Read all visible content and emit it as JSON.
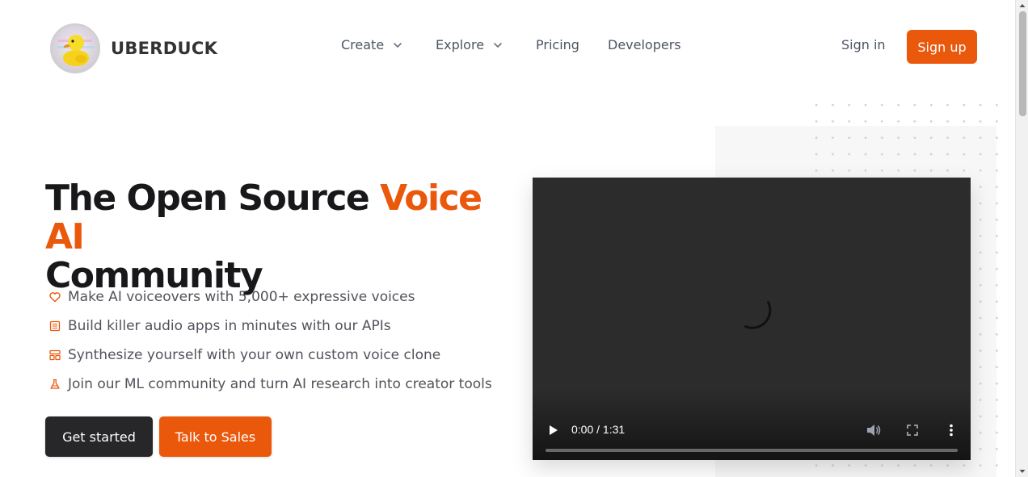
{
  "brand": {
    "name": "UBERDUCK"
  },
  "nav": {
    "items": [
      {
        "label": "Create",
        "has_dropdown": true
      },
      {
        "label": "Explore",
        "has_dropdown": true
      },
      {
        "label": "Pricing",
        "has_dropdown": false
      },
      {
        "label": "Developers",
        "has_dropdown": false
      }
    ],
    "sign_in": "Sign in",
    "sign_up": "Sign up"
  },
  "hero": {
    "headline_part1": "The Open Source ",
    "headline_accent": "Voice AI",
    "headline_part2": "Community",
    "features": [
      {
        "icon": "heart-icon",
        "text": "Make AI voiceovers with 5,000+ expressive voices"
      },
      {
        "icon": "document-list-icon",
        "text": "Build killer audio apps in minutes with our APIs"
      },
      {
        "icon": "layout-template-icon",
        "text": "Synthesize yourself with your own custom voice clone"
      },
      {
        "icon": "flask-icon",
        "text": "Join our ML community and turn AI research into creator tools"
      }
    ],
    "primary_cta": "Get started",
    "secondary_cta": "Talk to Sales"
  },
  "video": {
    "time_display": "0:00 / 1:31",
    "progress": 0.0,
    "state": "loading"
  },
  "colors": {
    "accent": "#ea580c",
    "dark_button": "#27272a",
    "video_bg": "#2c2c2c"
  }
}
